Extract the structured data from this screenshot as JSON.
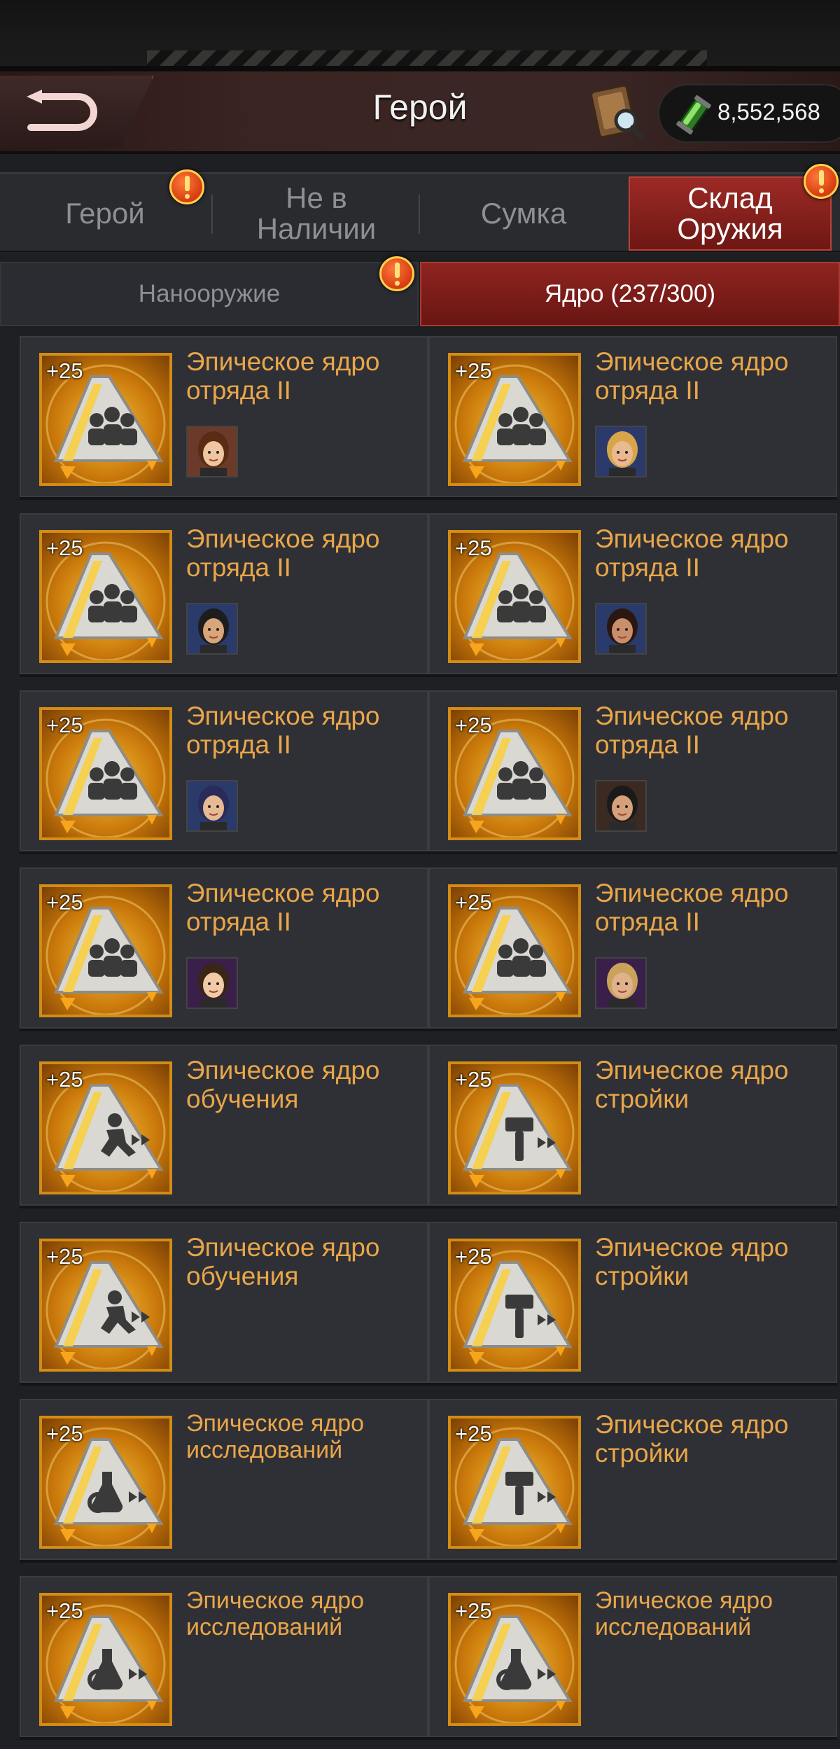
{
  "header": {
    "title": "Герой",
    "currency_amount": "8,552,568",
    "back_icon": "back-arrow-icon",
    "book_icon": "hero-book-icon",
    "currency_icon": "energy-cell-icon"
  },
  "tabs": [
    {
      "label": "Герой",
      "active": false,
      "alert": true
    },
    {
      "label": "Не в Наличии",
      "active": false,
      "alert": false
    },
    {
      "label": "Сумка",
      "active": false,
      "alert": false
    },
    {
      "label": "Склад Оружия",
      "active": true,
      "alert": true
    }
  ],
  "subtabs": {
    "nano": "Нанооружие",
    "core": "Ядро (237/300)",
    "nano_alert": true
  },
  "items": [
    {
      "level": "+25",
      "name": "Эпическое ядро отряда II",
      "icon": "squad-core-icon",
      "portrait": "hero-portrait-1"
    },
    {
      "level": "+25",
      "name": "Эпическое ядро отряда II",
      "icon": "squad-core-icon",
      "portrait": "hero-portrait-2"
    },
    {
      "level": "+25",
      "name": "Эпическое ядро отряда II",
      "icon": "squad-core-icon",
      "portrait": "hero-portrait-3"
    },
    {
      "level": "+25",
      "name": "Эпическое ядро отряда II",
      "icon": "squad-core-icon",
      "portrait": "hero-portrait-4"
    },
    {
      "level": "+25",
      "name": "Эпическое ядро отряда II",
      "icon": "squad-core-icon",
      "portrait": "hero-portrait-5"
    },
    {
      "level": "+25",
      "name": "Эпическое ядро отряда II",
      "icon": "squad-core-icon",
      "portrait": "hero-portrait-6"
    },
    {
      "level": "+25",
      "name": "Эпическое ядро отряда II",
      "icon": "squad-core-icon",
      "portrait": "hero-portrait-7"
    },
    {
      "level": "+25",
      "name": "Эпическое ядро отряда II",
      "icon": "squad-core-icon",
      "portrait": "hero-portrait-8"
    },
    {
      "level": "+25",
      "name": "Эпическое ядро обучения",
      "icon": "training-core-icon"
    },
    {
      "level": "+25",
      "name": "Эпическое ядро стройки",
      "icon": "construction-core-icon"
    },
    {
      "level": "+25",
      "name": "Эпическое ядро обучения",
      "icon": "training-core-icon"
    },
    {
      "level": "+25",
      "name": "Эпическое ядро стройки",
      "icon": "construction-core-icon"
    },
    {
      "level": "+25",
      "name": "Эпическое ядро исследований",
      "icon": "research-core-icon"
    },
    {
      "level": "+25",
      "name": "Эпическое ядро стройки",
      "icon": "construction-core-icon"
    },
    {
      "level": "+25",
      "name": "Эпическое ядро исследований",
      "icon": "research-core-icon"
    },
    {
      "level": "+25",
      "name": "Эпическое ядро исследований",
      "icon": "research-core-icon"
    }
  ],
  "colors": {
    "accent_red": "#8e2420",
    "item_name": "#e9a64a",
    "item_frame": "#d38c14"
  }
}
